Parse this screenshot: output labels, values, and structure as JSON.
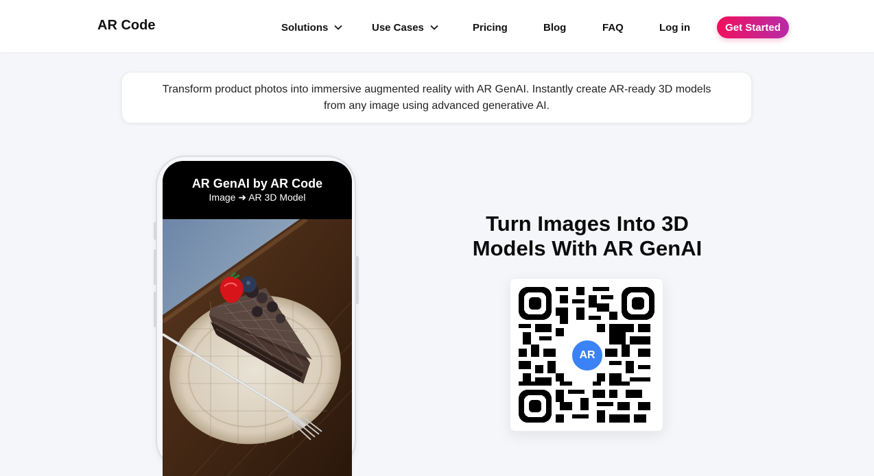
{
  "header": {
    "brand": "AR Code",
    "nav": [
      {
        "label": "Solutions",
        "has_dropdown": true
      },
      {
        "label": "Use Cases",
        "has_dropdown": true
      },
      {
        "label": "Pricing",
        "has_dropdown": false
      },
      {
        "label": "Blog",
        "has_dropdown": false
      },
      {
        "label": "FAQ",
        "has_dropdown": false
      },
      {
        "label": "Log in",
        "has_dropdown": false
      }
    ],
    "cta_label": "Get Started",
    "cta_gradient": [
      "#f0105d",
      "#b82ba8"
    ]
  },
  "intro": {
    "text": "Transform product photos into immersive augmented reality with AR GenAI. Instantly create AR-ready 3D models from any image using advanced generative AI."
  },
  "phone": {
    "title": "AR GenAI by AR Code",
    "subtitle": "Image ➜ AR 3D Model",
    "image_icon": "wireframe-cake-slice-image"
  },
  "hero": {
    "title": "Turn Images Into 3D Models With AR GenAI"
  },
  "qr": {
    "badge": "AR",
    "badge_color": "#3b82f6",
    "icon": "qr-code-icon"
  }
}
